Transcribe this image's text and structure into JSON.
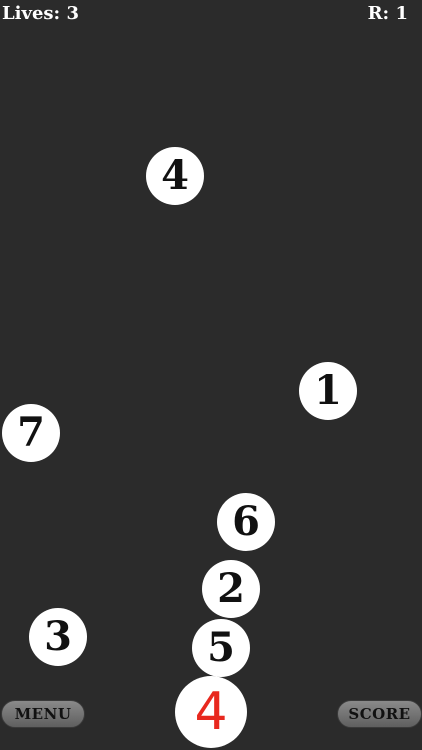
{
  "hud": {
    "lives": "Lives: 3",
    "round": "R: 1"
  },
  "balls": [
    {
      "id": "ball-4-top",
      "label": "4"
    },
    {
      "id": "ball-1",
      "label": "1"
    },
    {
      "id": "ball-7",
      "label": "7"
    },
    {
      "id": "ball-6",
      "label": "6"
    },
    {
      "id": "ball-2",
      "label": "2"
    },
    {
      "id": "ball-3",
      "label": "3"
    },
    {
      "id": "ball-5",
      "label": "5"
    }
  ],
  "player": {
    "label": "4",
    "color": "#e8281e"
  },
  "buttons": {
    "menu": "MENU",
    "score": "SCORE"
  },
  "colors": {
    "background": "#2b2b2b",
    "ball": "#ffffff",
    "text": "#111111"
  }
}
